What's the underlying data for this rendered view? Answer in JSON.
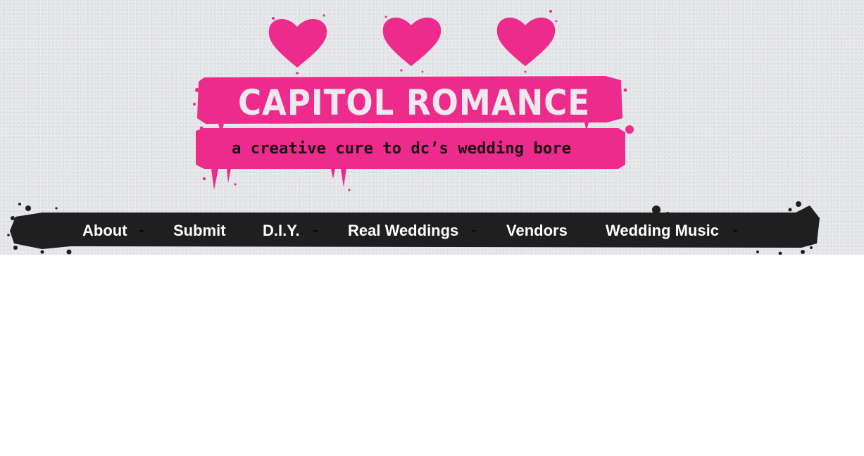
{
  "site": {
    "title": "CAPITOL ROMANCE",
    "tagline": "a creative cure to dc’s wedding bore",
    "brand_color": "#ec2b8c",
    "nav_color": "#1f1f1f",
    "background_color": "#e3e4e7"
  },
  "nav": {
    "items": [
      {
        "label": "About",
        "has_dropdown": true
      },
      {
        "label": "Submit",
        "has_dropdown": false
      },
      {
        "label": "D.I.Y.",
        "has_dropdown": true
      },
      {
        "label": "Real Weddings",
        "has_dropdown": true
      },
      {
        "label": "Vendors",
        "has_dropdown": false
      },
      {
        "label": "Wedding Music",
        "has_dropdown": true
      }
    ]
  },
  "icons": {
    "hearts": [
      "heart-icon",
      "heart-icon",
      "heart-icon"
    ],
    "dropdown": "chevron-down-icon"
  }
}
